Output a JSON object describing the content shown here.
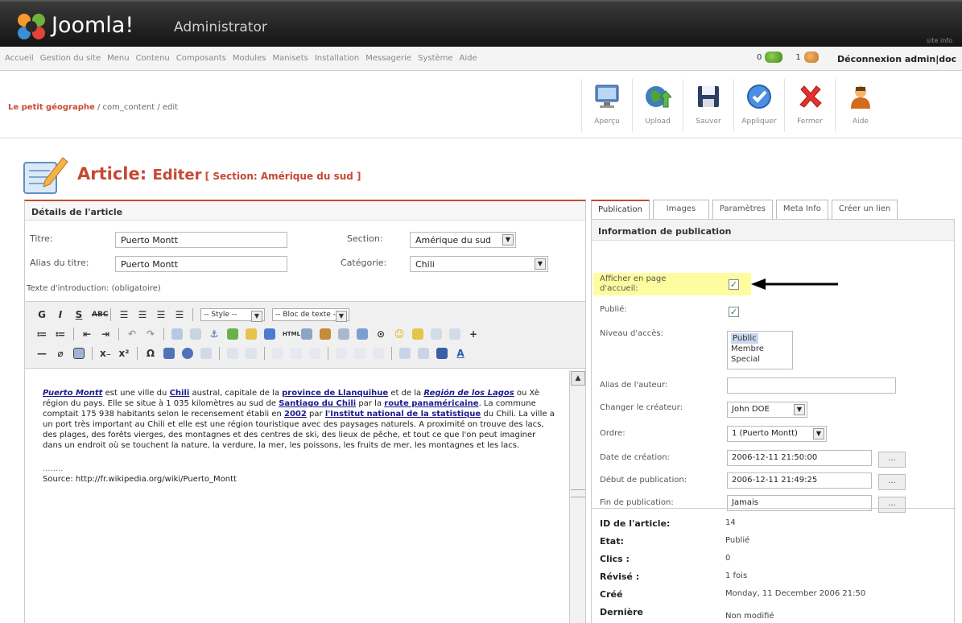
{
  "header": {
    "logo": "Joomla!",
    "subtitle": "Administrator",
    "right_text": "site info"
  },
  "menu": {
    "items": [
      "Accueil",
      "Gestion du site",
      "Menu",
      "Contenu",
      "Composants",
      "Modules",
      "Manisets",
      "Installation",
      "Messagerie",
      "Système",
      "Aide"
    ],
    "messages_count": "0",
    "users_count": "1",
    "logout": "Déconnexion admin|doc"
  },
  "breadcrumb": {
    "site": "Le petit géographe",
    "path": " / com_content / edit"
  },
  "toolbar": [
    {
      "label": "Aperçu",
      "icon": "preview-icon"
    },
    {
      "label": "Upload",
      "icon": "upload-icon"
    },
    {
      "label": "Sauver",
      "icon": "save-icon"
    },
    {
      "label": "Appliquer",
      "icon": "apply-icon"
    },
    {
      "label": "Fermer",
      "icon": "close-icon"
    },
    {
      "label": "Aide",
      "icon": "help-icon"
    }
  ],
  "page": {
    "title": "Article: ",
    "title_action": "Editer",
    "section_note": " [ Section: Amérique du sud ]"
  },
  "details": {
    "header": "Détails de l'article",
    "title_label": "Titre:",
    "title_value": "Puerto Montt",
    "alias_label": "Alias du titre:",
    "alias_value": "Puerto Montt",
    "section_label": "Section:",
    "section_value": "Amérique du sud",
    "category_label": "Catégorie:",
    "category_value": "Chili",
    "intro_label": "Texte d'introduction: (obligatoire)"
  },
  "editor_toolbar": {
    "style_select": "-- Style --",
    "block_select": "-- Bloc de texte --"
  },
  "editor": {
    "p1_link1": "Puerto Montt",
    "p1_t1": " est une ville du ",
    "p1_link2": "Chili",
    "p1_t2": " austral, capitale de la ",
    "p1_link3": "province de Llanquihue",
    "p1_t3": " et de la ",
    "p1_link4": "Región de los Lagos",
    "p1_t4": " ou Xè région du pays. Elle se situe à 1 035 kilomètres au sud de ",
    "p1_link5": "Santiago du Chili",
    "p1_t5": " par la ",
    "p1_link6": "route panaméricaine",
    "p1_t6": ". La commune comptait 175 938 habitants selon le recensement établi en ",
    "p1_link7": "2002",
    "p1_t7": " par ",
    "p1_link8": "l'Institut national de la statistique",
    "p1_t8": " du Chili. La ville a un port très important au Chili et elle est une région touristique avec des paysages naturels. A proximité on trouve des lacs, des plages, des forêts vierges, des montagnes et des centres de ski, des lieux de pêche, et tout ce que l'on peut imaginer dans un endroit où se touchent la nature, la verdure, la mer, les poissons, les fruits de mer, les montagnes et les lacs.",
    "separator": "........",
    "source": "Source: http://fr.wikipedia.org/wiki/Puerto_Montt"
  },
  "tabs": [
    "Publication",
    "Images",
    "Paramètres",
    "Meta Info",
    "Créer un lien"
  ],
  "publication": {
    "header": "Information de publication",
    "frontpage_label": "Afficher en page d'accueil:",
    "frontpage_checked": true,
    "published_label": "Publié:",
    "published_checked": true,
    "access_label": "Niveau d'accès:",
    "access_options": [
      "Public",
      "Membre",
      "Special"
    ],
    "access_selected": "Public",
    "author_alias_label": "Alias de l'auteur:",
    "author_alias_value": "",
    "creator_label": "Changer le créateur:",
    "creator_value": "John DOE",
    "order_label": "Ordre:",
    "order_value": "1 (Puerto Montt)",
    "created_label": "Date de création:",
    "created_value": "2006-12-11 21:50:00",
    "pub_start_label": "Début de publication:",
    "pub_start_value": "2006-12-11 21:49:25",
    "pub_end_label": "Fin de publication:",
    "pub_end_value": "Jamais",
    "calendar_btn": "..."
  },
  "article_info": {
    "id_label": "ID de l'article:",
    "id_value": "14",
    "state_label": "Etat:",
    "state_value": "Publié",
    "hits_label": "Clics :",
    "hits_value": "0",
    "revised_label": "Révisé :",
    "revised_value": "1 fois",
    "created_label": "Créé",
    "created_value": "Monday, 11 December 2006 21:50",
    "modified_label": "Dernière",
    "modified_value": "Non modifié"
  },
  "colors": {
    "accent": "#c64934",
    "highlight": "#fdfda0",
    "link": "#1a1a8c"
  }
}
